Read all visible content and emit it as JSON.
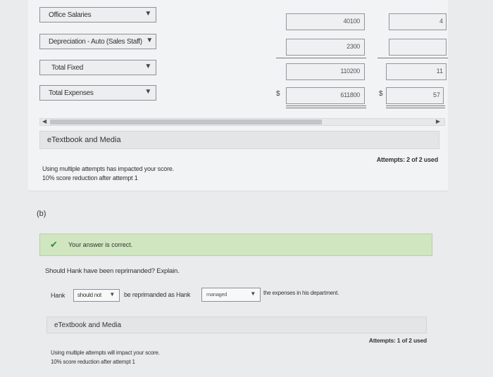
{
  "top": {
    "rows": [
      {
        "label": "Office Salaries",
        "value": "40100",
        "value2": "4",
        "dollar": ""
      },
      {
        "label": "Depreciation - Auto (Sales Staff)",
        "value": "2300",
        "value2": "",
        "dollar": ""
      },
      {
        "label": "Total Fixed",
        "value": "110200",
        "value2": "11",
        "dollar": ""
      },
      {
        "label": "Total Expenses",
        "value": "611800",
        "value2": "57",
        "dollar": "$"
      }
    ],
    "etextbook_label": "eTextbook and Media",
    "attempts": "Attempts: 2 of 2 used",
    "note_line1": "Using multiple attempts has impacted your score.",
    "note_line2": "10% score reduction after attempt 1"
  },
  "part_b": {
    "label": "(b)",
    "correct_msg": "Your answer is correct.",
    "question": "Should Hank have been reprimanded? Explain.",
    "sentence_start": "Hank",
    "select1_value": "should not",
    "sentence_mid": "be reprimanded as Hank",
    "select2_value": "managed",
    "sentence_end": "the expenses in his department.",
    "etextbook_label": "eTextbook and Media",
    "attempts": "Attempts: 1 of 2 used",
    "note_line1": "Using multiple attempts will impact your score.",
    "note_line2": "10% score reduction after attempt 1"
  },
  "colors": {
    "success_bg": "#cfe6c0",
    "check": "#2e8b2e"
  }
}
